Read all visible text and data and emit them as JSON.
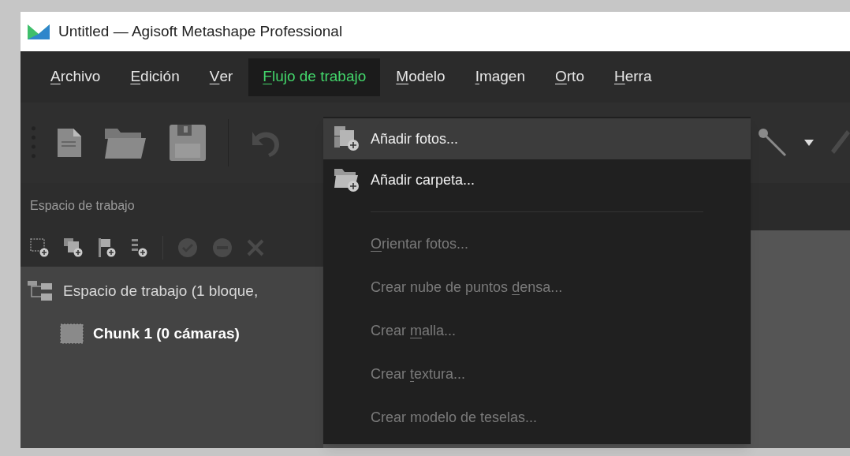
{
  "window": {
    "title": "Untitled — Agisoft Metashape Professional"
  },
  "menu_bar": [
    {
      "parts": {
        "key": "A",
        "after": "rchivo"
      },
      "selected": false
    },
    {
      "parts": {
        "key": "E",
        "after": "dición"
      },
      "selected": false
    },
    {
      "parts": {
        "key": "V",
        "after": "er"
      },
      "selected": false
    },
    {
      "parts": {
        "key": "F",
        "after": "lujo de trabajo"
      },
      "selected": true
    },
    {
      "parts": {
        "key": "M",
        "after": "odelo"
      },
      "selected": false
    },
    {
      "parts": {
        "key": "I",
        "after": "magen"
      },
      "selected": false
    },
    {
      "parts": {
        "key": "O",
        "after": "rto"
      },
      "selected": false
    },
    {
      "parts": {
        "key": "H",
        "after": "erra"
      },
      "selected": false
    }
  ],
  "toolbar_left": [
    {
      "kind": "new",
      "disabled": false
    },
    {
      "kind": "open",
      "disabled": false
    },
    {
      "kind": "save",
      "disabled": false
    },
    {
      "kind": "separator"
    },
    {
      "kind": "undo",
      "disabled": true
    }
  ],
  "toolbar_right": [
    {
      "kind": "measure",
      "disabled": false
    },
    {
      "kind": "dropdown",
      "disabled": false
    },
    {
      "kind": "ruler",
      "disabled": true
    }
  ],
  "workspace_panel": {
    "title": "Espacio de trabajo",
    "tools": [
      {
        "kind": "add-chunk",
        "disabled": false
      },
      {
        "kind": "add-photos",
        "disabled": false
      },
      {
        "kind": "add-marker",
        "disabled": false
      },
      {
        "kind": "add-list",
        "disabled": false
      },
      {
        "kind": "separator"
      },
      {
        "kind": "check",
        "disabled": true
      },
      {
        "kind": "minus",
        "disabled": true
      },
      {
        "kind": "remove",
        "disabled": true
      }
    ],
    "tree": [
      {
        "label": "Espacio de trabajo (1 bloque,",
        "children": [
          {
            "label": "Chunk 1 (0 cámaras)"
          }
        ]
      }
    ]
  },
  "workflow_menu": {
    "items": [
      {
        "kind": "add-photos",
        "label": "Añadir fotos...",
        "highlighted": true,
        "disabled": false
      },
      {
        "kind": "add-folder",
        "label": "Añadir carpeta...",
        "highlighted": false,
        "disabled": false
      },
      {
        "kind": "separator"
      },
      {
        "kind": "command",
        "parts": {
          "key": "O",
          "after": "rientar fotos..."
        },
        "highlighted": false,
        "disabled": true
      },
      {
        "kind": "command",
        "parts": {
          "before": "Crear nube de puntos ",
          "key": "d",
          "after": "ensa..."
        },
        "highlighted": false,
        "disabled": true
      },
      {
        "kind": "command",
        "parts": {
          "before": "Crear ",
          "key": "m",
          "after": "alla..."
        },
        "highlighted": false,
        "disabled": true
      },
      {
        "kind": "command",
        "parts": {
          "before": "Crear ",
          "key": "t",
          "after": "extura..."
        },
        "highlighted": false,
        "disabled": true
      },
      {
        "kind": "command",
        "label": "Crear modelo de teselas...",
        "highlighted": false,
        "disabled": true
      }
    ]
  }
}
